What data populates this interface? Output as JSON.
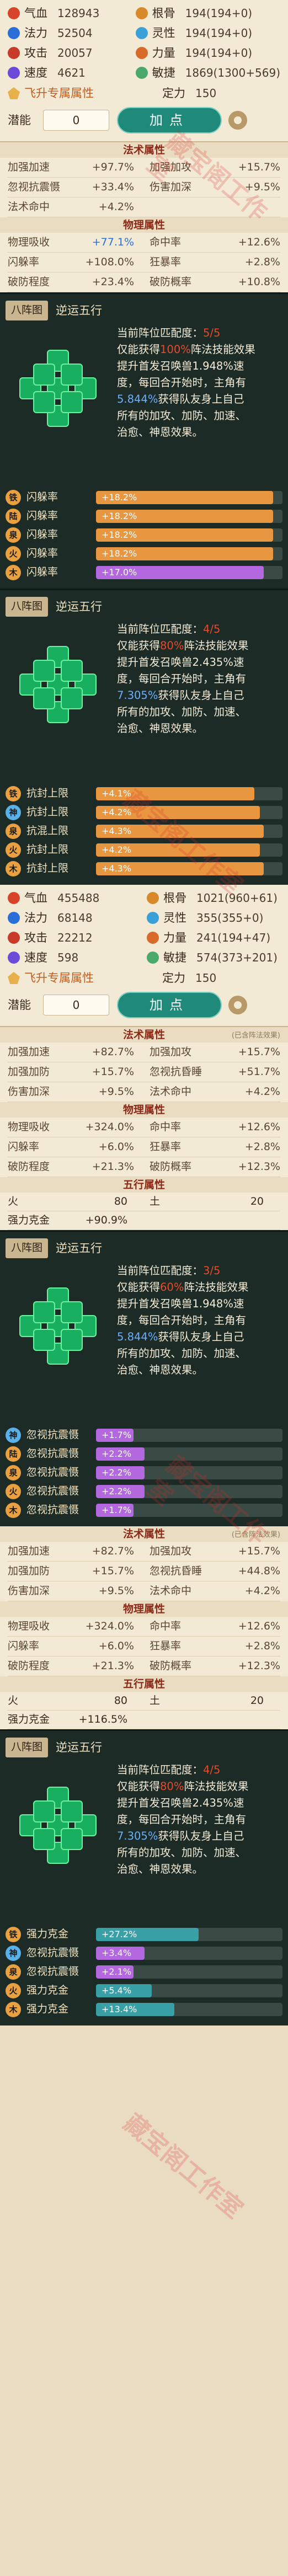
{
  "pet1": {
    "stats": [
      {
        "label": "气血",
        "value": "128943",
        "icon_color": "#d8442a"
      },
      {
        "label": "根骨",
        "value": "194(194+0)",
        "icon_color": "#d88a2a"
      },
      {
        "label": "法力",
        "value": "52504",
        "icon_color": "#2a6ed8"
      },
      {
        "label": "灵性",
        "value": "194(194+0)",
        "icon_color": "#3aa0d8"
      },
      {
        "label": "攻击",
        "value": "20057",
        "icon_color": "#c83a2a"
      },
      {
        "label": "力量",
        "value": "194(194+0)",
        "icon_color": "#d86a2a"
      },
      {
        "label": "速度",
        "value": "4621",
        "icon_color": "#6a4ad8"
      },
      {
        "label": "敏捷",
        "value": "1869(1300+569)",
        "icon_color": "#4aa86a"
      }
    ],
    "feisheng_label": "飞升专属属性",
    "dingli_label": "定力",
    "dingli_value": "150",
    "potential_label": "潜能",
    "potential_value": "0",
    "add_button": "加点",
    "fashu_header": "法术属性",
    "fashu": [
      [
        "加强加速",
        "+97.7%"
      ],
      [
        "加强加攻",
        "+15.7%"
      ],
      [
        "忽视抗震慑",
        "+33.4%"
      ],
      [
        "伤害加深",
        "+9.5%"
      ],
      [
        "法术命中",
        "+4.2%"
      ],
      [
        "",
        ""
      ]
    ],
    "wuli_header": "物理属性",
    "wuli": [
      [
        "物理吸收",
        "+77.1%",
        "blue"
      ],
      [
        "命中率",
        "+12.6%",
        ""
      ],
      [
        "闪躲率",
        "+108.0%",
        ""
      ],
      [
        "狂暴率",
        "+2.8%",
        ""
      ],
      [
        "破防程度",
        "+23.4%",
        ""
      ],
      [
        "破防概率",
        "+10.8%",
        ""
      ]
    ]
  },
  "formations": [
    {
      "tag": "八阵图",
      "name": "逆运五行",
      "desc": [
        {
          "text": "当前阵位匹配度：",
          "class": ""
        },
        {
          "text": "5/5",
          "class": "red"
        },
        {
          "br": true
        },
        {
          "text": "仅能获得",
          "class": ""
        },
        {
          "text": "100%",
          "class": "red"
        },
        {
          "text": "阵法技能效果",
          "class": ""
        },
        {
          "br": true
        },
        {
          "text": "提升首发召唤兽",
          "class": ""
        },
        {
          "text": "1.948%",
          "class": ""
        },
        {
          "text": "速",
          "class": ""
        },
        {
          "br": true
        },
        {
          "text": "度，每回合开始时，主角有",
          "class": ""
        },
        {
          "br": true
        },
        {
          "text": "5.844%",
          "class": "blue"
        },
        {
          "text": "获得队友身上自己",
          "class": ""
        },
        {
          "br": true
        },
        {
          "text": "所有的加攻、加防、加速、",
          "class": ""
        },
        {
          "br": true
        },
        {
          "text": "治愈、神恩效果。",
          "class": ""
        }
      ],
      "active": [
        0,
        1,
        2,
        3,
        4,
        5,
        6,
        7,
        8
      ],
      "bars": [
        {
          "badge": "铁",
          "badge_color": "#e8a040",
          "label": "闪躲率",
          "value": "+18.2%",
          "fill": 0.95,
          "color": "#e89640"
        },
        {
          "badge": "陆",
          "badge_color": "#e8a040",
          "label": "闪躲率",
          "value": "+18.2%",
          "fill": 0.95,
          "color": "#e89640"
        },
        {
          "badge": "泉",
          "badge_color": "#e8a040",
          "label": "闪躲率",
          "value": "+18.2%",
          "fill": 0.95,
          "color": "#e89640"
        },
        {
          "badge": "火",
          "badge_color": "#e8a040",
          "label": "闪躲率",
          "value": "+18.2%",
          "fill": 0.95,
          "color": "#e89640"
        },
        {
          "badge": "木",
          "badge_color": "#e8a040",
          "label": "闪躲率",
          "value": "+17.0%",
          "fill": 0.9,
          "color": "#b468e0"
        }
      ]
    },
    {
      "tag": "八阵图",
      "name": "逆运五行",
      "desc": [
        {
          "text": "当前阵位匹配度：",
          "class": ""
        },
        {
          "text": "4/5",
          "class": "red"
        },
        {
          "br": true
        },
        {
          "text": "仅能获得",
          "class": ""
        },
        {
          "text": "80%",
          "class": "red"
        },
        {
          "text": "阵法技能效果",
          "class": ""
        },
        {
          "br": true
        },
        {
          "text": "提升首发召唤兽",
          "class": ""
        },
        {
          "text": "2.435%",
          "class": ""
        },
        {
          "text": "速",
          "class": ""
        },
        {
          "br": true
        },
        {
          "text": "度，每回合开始时，主角有",
          "class": ""
        },
        {
          "br": true
        },
        {
          "text": "7.305%",
          "class": "blue"
        },
        {
          "text": "获得队友身上自己",
          "class": ""
        },
        {
          "br": true
        },
        {
          "text": "所有的加攻、加防、加速、",
          "class": ""
        },
        {
          "br": true
        },
        {
          "text": "治愈、神恩效果。",
          "class": ""
        }
      ],
      "active": [
        0,
        1,
        2,
        3,
        4,
        5,
        6,
        7,
        8
      ],
      "bars": [
        {
          "badge": "铁",
          "badge_color": "#e8a040",
          "label": "抗封上限",
          "value": "+4.1%",
          "fill": 0.85,
          "color": "#e89640"
        },
        {
          "badge": "神",
          "badge_color": "#5ab0e8",
          "label": "抗封上限",
          "value": "+4.2%",
          "fill": 0.88,
          "color": "#e89640"
        },
        {
          "badge": "泉",
          "badge_color": "#e8a040",
          "label": "抗混上限",
          "value": "+4.3%",
          "fill": 0.9,
          "color": "#e89640"
        },
        {
          "badge": "火",
          "badge_color": "#e8a040",
          "label": "抗封上限",
          "value": "+4.2%",
          "fill": 0.88,
          "color": "#e89640"
        },
        {
          "badge": "木",
          "badge_color": "#e8a040",
          "label": "抗封上限",
          "value": "+4.3%",
          "fill": 0.9,
          "color": "#e89640"
        }
      ]
    }
  ],
  "pet2": {
    "stats": [
      {
        "label": "气血",
        "value": "455488",
        "icon_color": "#d8442a"
      },
      {
        "label": "根骨",
        "value": "1021(960+61)",
        "icon_color": "#d88a2a"
      },
      {
        "label": "法力",
        "value": "68148",
        "icon_color": "#2a6ed8"
      },
      {
        "label": "灵性",
        "value": "355(355+0)",
        "icon_color": "#3aa0d8"
      },
      {
        "label": "攻击",
        "value": "22212",
        "icon_color": "#c83a2a"
      },
      {
        "label": "力量",
        "value": "241(194+47)",
        "icon_color": "#d86a2a"
      },
      {
        "label": "速度",
        "value": "598",
        "icon_color": "#6a4ad8"
      },
      {
        "label": "敏捷",
        "value": "574(373+201)",
        "icon_color": "#4aa86a"
      }
    ],
    "feisheng_label": "飞升专属属性",
    "dingli_label": "定力",
    "dingli_value": "150",
    "potential_label": "潜能",
    "potential_value": "0",
    "add_button": "加点",
    "fashu_header": "法术属性",
    "fashu_note": "(已含阵法效果)",
    "fashu": [
      [
        "加强加速",
        "+82.7%"
      ],
      [
        "加强加攻",
        "+15.7%"
      ],
      [
        "加强加防",
        "+15.7%"
      ],
      [
        "忽视抗昏睡",
        "+51.7%"
      ],
      [
        "伤害加深",
        "+9.5%"
      ],
      [
        "法术命中",
        "+4.2%"
      ]
    ],
    "wuli_header": "物理属性",
    "wuli": [
      [
        "物理吸收",
        "+324.0%",
        ""
      ],
      [
        "命中率",
        "+12.6%",
        ""
      ],
      [
        "闪躲率",
        "+6.0%",
        ""
      ],
      [
        "狂暴率",
        "+2.8%",
        ""
      ],
      [
        "破防程度",
        "+21.3%",
        ""
      ],
      [
        "破防概率",
        "+12.3%",
        ""
      ]
    ],
    "wuxing_header": "五行属性",
    "wuxing": [
      [
        "火",
        "80"
      ],
      [
        "土",
        "20"
      ]
    ],
    "qiangli": [
      "强力克金",
      "+90.9%"
    ]
  },
  "formation3": {
    "tag": "八阵图",
    "name": "逆运五行",
    "desc": [
      {
        "text": "当前阵位匹配度：",
        "class": ""
      },
      {
        "text": "3/5",
        "class": "red"
      },
      {
        "br": true
      },
      {
        "text": "仅能获得",
        "class": ""
      },
      {
        "text": "60%",
        "class": "red"
      },
      {
        "text": "阵法技能效果",
        "class": ""
      },
      {
        "br": true
      },
      {
        "text": "提升首发召唤兽",
        "class": ""
      },
      {
        "text": "1.948%",
        "class": ""
      },
      {
        "text": "速",
        "class": ""
      },
      {
        "br": true
      },
      {
        "text": "度，每回合开始时，主角有",
        "class": ""
      },
      {
        "br": true
      },
      {
        "text": "5.844%",
        "class": "blue"
      },
      {
        "text": "获得队友身上自己",
        "class": ""
      },
      {
        "br": true
      },
      {
        "text": "所有的加攻、加防、加速、",
        "class": ""
      },
      {
        "br": true
      },
      {
        "text": "治愈、神恩效果。",
        "class": ""
      }
    ],
    "active": [
      0,
      1,
      2,
      3,
      4,
      5,
      6,
      7,
      8
    ],
    "bars": [
      {
        "badge": "神",
        "badge_color": "#5ab0e8",
        "label": "忽视抗震慑",
        "value": "+1.7%",
        "fill": 0.2,
        "color": "#b468e0"
      },
      {
        "badge": "陆",
        "badge_color": "#e8a040",
        "label": "忽视抗震慑",
        "value": "+2.2%",
        "fill": 0.26,
        "color": "#b468e0"
      },
      {
        "badge": "泉",
        "badge_color": "#e8a040",
        "label": "忽视抗震慑",
        "value": "+2.2%",
        "fill": 0.26,
        "color": "#b468e0"
      },
      {
        "badge": "火",
        "badge_color": "#e8a040",
        "label": "忽视抗震慑",
        "value": "+2.2%",
        "fill": 0.26,
        "color": "#b468e0"
      },
      {
        "badge": "木",
        "badge_color": "#e8a040",
        "label": "忽视抗震慑",
        "value": "+1.7%",
        "fill": 0.2,
        "color": "#b468e0"
      }
    ]
  },
  "pet3": {
    "fashu_header": "法术属性",
    "fashu_note": "(已含阵法效果)",
    "fashu": [
      [
        "加强加速",
        "+82.7%"
      ],
      [
        "加强加攻",
        "+15.7%"
      ],
      [
        "加强加防",
        "+15.7%"
      ],
      [
        "忽视抗昏睡",
        "+44.8%"
      ],
      [
        "伤害加深",
        "+9.5%"
      ],
      [
        "法术命中",
        "+4.2%"
      ]
    ],
    "wuli_header": "物理属性",
    "wuli": [
      [
        "物理吸收",
        "+324.0%",
        ""
      ],
      [
        "命中率",
        "+12.6%",
        ""
      ],
      [
        "闪躲率",
        "+6.0%",
        ""
      ],
      [
        "狂暴率",
        "+2.8%",
        ""
      ],
      [
        "破防程度",
        "+21.3%",
        ""
      ],
      [
        "破防概率",
        "+12.3%",
        ""
      ]
    ],
    "wuxing_header": "五行属性",
    "wuxing": [
      [
        "火",
        "80"
      ],
      [
        "土",
        "20"
      ]
    ],
    "qiangli": [
      "强力克金",
      "+116.5%"
    ]
  },
  "formation4": {
    "tag": "八阵图",
    "name": "逆运五行",
    "desc": [
      {
        "text": "当前阵位匹配度：",
        "class": ""
      },
      {
        "text": "4/5",
        "class": "red"
      },
      {
        "br": true
      },
      {
        "text": "仅能获得",
        "class": ""
      },
      {
        "text": "80%",
        "class": "red"
      },
      {
        "text": "阵法技能效果",
        "class": ""
      },
      {
        "br": true
      },
      {
        "text": "提升首发召唤兽",
        "class": ""
      },
      {
        "text": "2.435%",
        "class": ""
      },
      {
        "text": "速",
        "class": ""
      },
      {
        "br": true
      },
      {
        "text": "度，每回合开始时，主角有",
        "class": ""
      },
      {
        "br": true
      },
      {
        "text": "7.305%",
        "class": "blue"
      },
      {
        "text": "获得队友身上自己",
        "class": ""
      },
      {
        "br": true
      },
      {
        "text": "所有的加攻、加防、加速、",
        "class": ""
      },
      {
        "br": true
      },
      {
        "text": "治愈、神恩效果。",
        "class": ""
      }
    ],
    "active": [
      0,
      1,
      2,
      3,
      4,
      5,
      6,
      7,
      8
    ],
    "bars": [
      {
        "badge": "铁",
        "badge_color": "#e8a040",
        "label": "强力克金",
        "value": "+27.2%",
        "fill": 0.55,
        "color": "#3aa0a8"
      },
      {
        "badge": "神",
        "badge_color": "#5ab0e8",
        "label": "忽视抗震慑",
        "value": "+3.4%",
        "fill": 0.26,
        "color": "#b468e0"
      },
      {
        "badge": "泉",
        "badge_color": "#e8a040",
        "label": "忽视抗震慑",
        "value": "+2.1%",
        "fill": 0.2,
        "color": "#b468e0"
      },
      {
        "badge": "火",
        "badge_color": "#e8a040",
        "label": "强力克金",
        "value": "+5.4%",
        "fill": 0.3,
        "color": "#3aa0a8"
      },
      {
        "badge": "木",
        "badge_color": "#e8a040",
        "label": "强力克金",
        "value": "+13.4%",
        "fill": 0.42,
        "color": "#3aa0a8"
      }
    ]
  },
  "watermark_text": "藏宝阁工作室"
}
